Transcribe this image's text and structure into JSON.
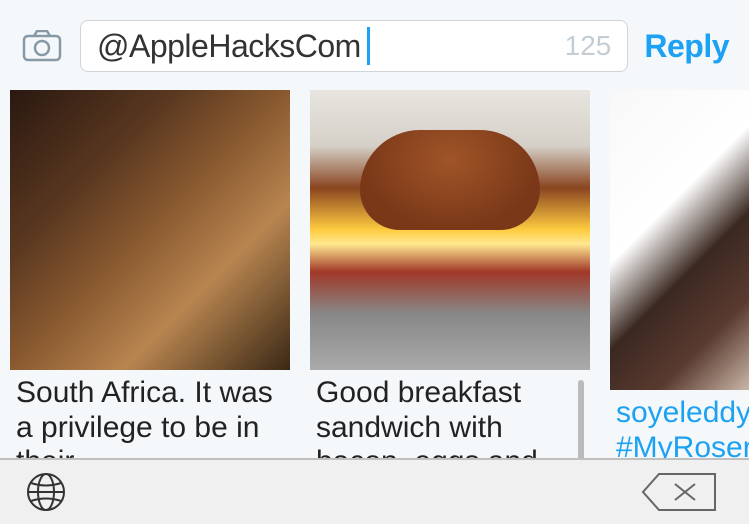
{
  "compose": {
    "value": "@AppleHacksCom",
    "char_count": "125",
    "reply_label": "Reply"
  },
  "cards": [
    {
      "caption": "South Africa. It was a privilege to be in their"
    },
    {
      "caption": "Good breakfast sandwich with bacon, eggs and"
    },
    {
      "caption": "soyeleddy #MyRoser"
    }
  ]
}
